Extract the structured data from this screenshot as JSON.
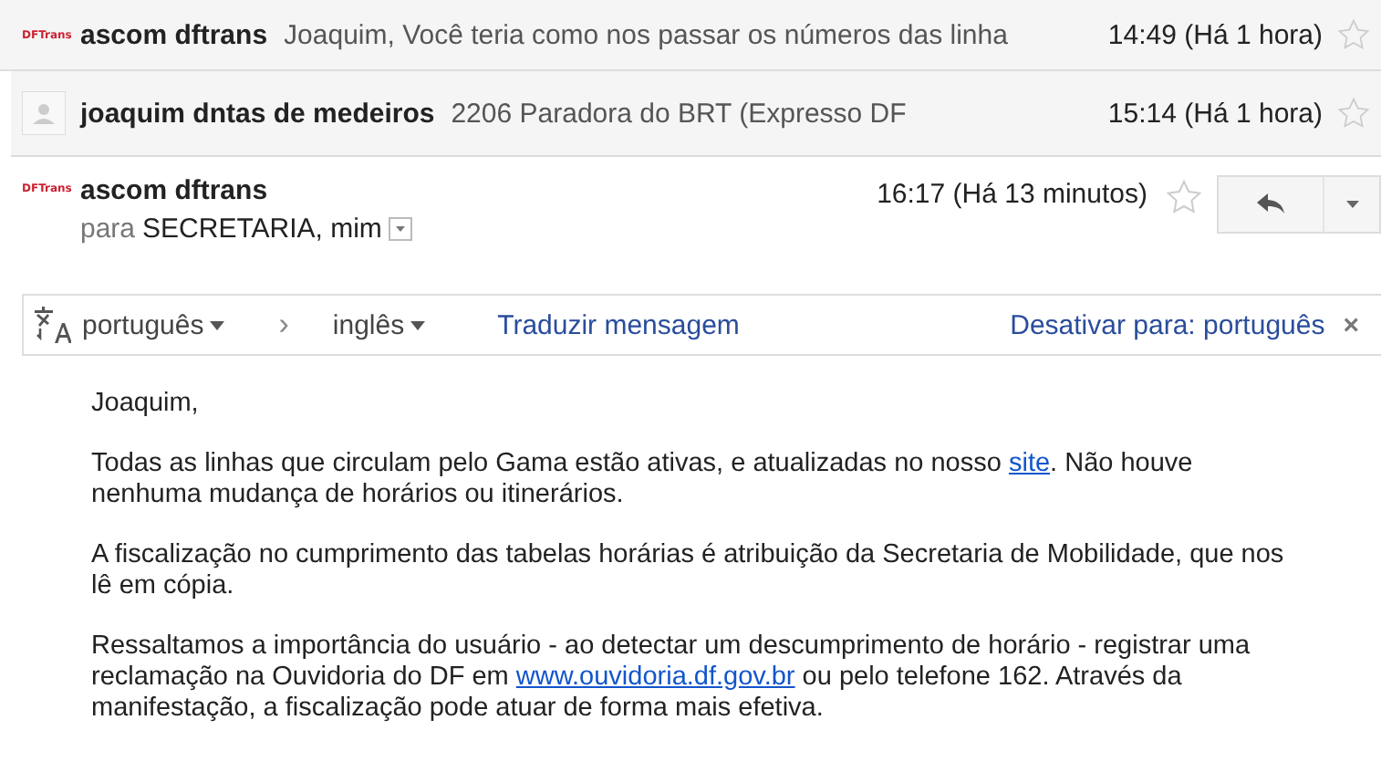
{
  "messages": [
    {
      "collapsed": true,
      "avatar": {
        "kind": "logo",
        "text": "DFTrans"
      },
      "sender": "ascom dftrans",
      "snippet": "Joaquim, Você teria como nos passar os números das linha",
      "time": "14:49 (Há 1 hora)",
      "starred": false
    },
    {
      "collapsed": true,
      "avatar": {
        "kind": "silhouette"
      },
      "sender": "joaquim dntas de medeiros",
      "snippet": "2206 Paradora do BRT (Expresso DF",
      "time": "15:14 (Há 1 hora)",
      "starred": false
    },
    {
      "collapsed": false,
      "avatar": {
        "kind": "logo",
        "text": "DFTrans"
      },
      "sender": "ascom dftrans",
      "to_label": "para",
      "recipients": "SECRETARIA, mim",
      "time": "16:17 (Há 13 minutos)",
      "starred": false
    }
  ],
  "translate_bar": {
    "from": "português",
    "arrow": "›",
    "to": "inglês",
    "action": "Traduzir mensagem",
    "disable": "Desativar para: português",
    "close": "×"
  },
  "body": [
    [
      {
        "text": "Joaquim,"
      }
    ],
    [
      {
        "text": "Todas as linhas que circulam pelo Gama estão ativas, e atualizadas no nosso "
      },
      {
        "link": "site"
      },
      {
        "text": ". Não houve nenhuma mudança de horários ou itinerários."
      }
    ],
    [
      {
        "text": "A fiscalização no cumprimento das tabelas horárias é atribuição da Secretaria de Mobilidade, que nos lê em cópia."
      }
    ],
    [
      {
        "text": "Ressaltamos a importância do usuário - ao detectar um descumprimento de horário - registrar uma reclamação na Ouvidoria do DF em "
      },
      {
        "link": "www.ouvidoria.df.gov.br"
      },
      {
        "text": " ou pelo telefone 162. Através da manifestação, a fiscalização pode atuar de forma mais efetiva."
      }
    ]
  ]
}
